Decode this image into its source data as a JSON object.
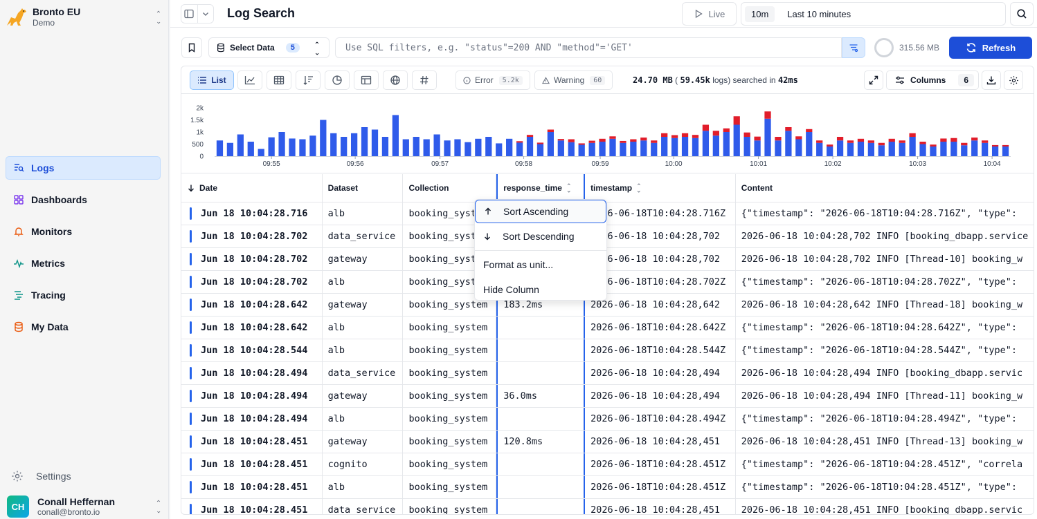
{
  "sidebar": {
    "org_name": "Bronto EU",
    "org_sub": "Demo",
    "nav": [
      {
        "label": "Logs",
        "icon": "logs-icon",
        "active": true
      },
      {
        "label": "Dashboards",
        "icon": "dashboards-icon"
      },
      {
        "label": "Monitors",
        "icon": "bell-icon"
      },
      {
        "label": "Metrics",
        "icon": "activity-icon"
      },
      {
        "label": "Tracing",
        "icon": "tracing-icon"
      },
      {
        "label": "My Data",
        "icon": "database-icon"
      }
    ],
    "settings_label": "Settings",
    "user": {
      "initials": "CH",
      "name": "Conall Heffernan",
      "email": "conall@bronto.io"
    }
  },
  "topbar": {
    "title": "Log Search",
    "live_label": "Live",
    "time_chip": "10m",
    "time_range": "Last 10 minutes"
  },
  "filter": {
    "select_label": "Select Data",
    "select_count": "5",
    "sql_placeholder": "Use SQL filters, e.g. \"status\"=200 AND \"method\"='GET'",
    "memory": "315.56 MB",
    "refresh_label": "Refresh"
  },
  "toolbar": {
    "list_label": "List",
    "error_label": "Error",
    "error_count": "5.2k",
    "warning_label": "Warning",
    "warning_count": "60",
    "stats_size": "24.70 MB",
    "stats_open": "(",
    "stats_logs": "59.45k",
    "stats_logs_unit": "logs)",
    "stats_searched": "searched",
    "stats_in": "in",
    "stats_time": "42ms",
    "columns_label": "Columns",
    "columns_count": "6"
  },
  "colors": {
    "info_bar": "#2f5bea",
    "error_bar": "#e11d2a",
    "accent": "#1d4ed8"
  },
  "chart_data": {
    "type": "bar",
    "stacked": true,
    "y_ticks": [
      "2k",
      "1.5k",
      "1k",
      "500",
      "0"
    ],
    "x_ticks": [
      "09:55",
      "09:56",
      "09:57",
      "09:58",
      "09:59",
      "10:00",
      "10:01",
      "10:02",
      "10:03",
      "10:04"
    ],
    "ylim": [
      0,
      2000
    ],
    "series": [
      {
        "values": [
          650,
          550,
          900,
          600,
          300,
          780,
          1000,
          730,
          700,
          850,
          1500,
          950,
          800,
          950,
          1200,
          1100,
          800,
          1700,
          700,
          800,
          700,
          900,
          650,
          700,
          580,
          720,
          800,
          530,
          720,
          560,
          800,
          500,
          1000,
          650,
          580,
          470,
          550,
          600,
          720,
          550,
          600,
          650,
          550,
          800,
          750,
          800,
          750,
          1050,
          850,
          1000,
          1300,
          800,
          650,
          1550,
          650,
          1050,
          700,
          1000,
          550,
          400,
          650,
          550,
          600,
          550,
          450,
          600,
          550,
          800,
          500,
          400,
          600,
          600,
          450,
          650,
          550,
          400,
          400
        ]
      },
      {
        "name": "Error",
        "values": [
          0,
          0,
          0,
          0,
          0,
          0,
          0,
          0,
          0,
          0,
          0,
          0,
          0,
          0,
          0,
          0,
          0,
          0,
          0,
          0,
          0,
          0,
          0,
          0,
          0,
          0,
          0,
          0,
          0,
          60,
          80,
          60,
          100,
          60,
          120,
          60,
          90,
          120,
          100,
          80,
          100,
          120,
          100,
          150,
          120,
          150,
          130,
          250,
          200,
          150,
          350,
          180,
          160,
          300,
          150,
          150,
          120,
          120,
          100,
          80,
          150,
          100,
          120,
          100,
          100,
          120,
          100,
          150,
          100,
          80,
          130,
          150,
          100,
          120,
          100,
          60,
          60
        ]
      }
    ]
  },
  "table": {
    "columns": [
      "Date",
      "Dataset",
      "Collection",
      "response_time",
      "timestamp",
      "Content"
    ],
    "rows": [
      {
        "date": "Jun 18 10:04:28.716",
        "dataset": "alb",
        "collection": "booking_system",
        "rt": "",
        "ts": "2026-06-18T10:04:28.716Z",
        "content": "{\"timestamp\": \"2026-06-18T10:04:28.716Z\", \"type\":"
      },
      {
        "date": "Jun 18 10:04:28.702",
        "dataset": "data_service",
        "collection": "booking_system",
        "rt": "",
        "ts": "2026-06-18 10:04:28,702",
        "content": "2026-06-18 10:04:28,702 INFO [booking_dbapp.service"
      },
      {
        "date": "Jun 18 10:04:28.702",
        "dataset": "gateway",
        "collection": "booking_system",
        "rt": "",
        "ts": "2026-06-18 10:04:28,702",
        "content": "2026-06-18 10:04:28,702 INFO [Thread-10] booking_w"
      },
      {
        "date": "Jun 18 10:04:28.702",
        "dataset": "alb",
        "collection": "booking_system",
        "rt": "",
        "ts": "2026-06-18T10:04:28.702Z",
        "content": "{\"timestamp\": \"2026-06-18T10:04:28.702Z\", \"type\":"
      },
      {
        "date": "Jun 18 10:04:28.642",
        "dataset": "gateway",
        "collection": "booking_system",
        "rt": "183.2ms",
        "ts": "2026-06-18 10:04:28,642",
        "content": "2026-06-18 10:04:28,642 INFO [Thread-18] booking_w"
      },
      {
        "date": "Jun 18 10:04:28.642",
        "dataset": "alb",
        "collection": "booking_system",
        "rt": "",
        "ts": "2026-06-18T10:04:28.642Z",
        "content": "{\"timestamp\": \"2026-06-18T10:04:28.642Z\", \"type\":"
      },
      {
        "date": "Jun 18 10:04:28.544",
        "dataset": "alb",
        "collection": "booking_system",
        "rt": "",
        "ts": "2026-06-18T10:04:28.544Z",
        "content": "{\"timestamp\": \"2026-06-18T10:04:28.544Z\", \"type\":"
      },
      {
        "date": "Jun 18 10:04:28.494",
        "dataset": "data_service",
        "collection": "booking_system",
        "rt": "",
        "ts": "2026-06-18 10:04:28,494",
        "content": "2026-06-18 10:04:28,494 INFO [booking_dbapp.servic"
      },
      {
        "date": "Jun 18 10:04:28.494",
        "dataset": "gateway",
        "collection": "booking_system",
        "rt": "36.0ms",
        "ts": "2026-06-18 10:04:28,494",
        "content": "2026-06-18 10:04:28,494 INFO [Thread-11] booking_w"
      },
      {
        "date": "Jun 18 10:04:28.494",
        "dataset": "alb",
        "collection": "booking_system",
        "rt": "",
        "ts": "2026-06-18T10:04:28.494Z",
        "content": "{\"timestamp\": \"2026-06-18T10:04:28.494Z\", \"type\":"
      },
      {
        "date": "Jun 18 10:04:28.451",
        "dataset": "gateway",
        "collection": "booking_system",
        "rt": "120.8ms",
        "ts": "2026-06-18 10:04:28,451",
        "content": "2026-06-18 10:04:28,451 INFO [Thread-13] booking_w"
      },
      {
        "date": "Jun 18 10:04:28.451",
        "dataset": "cognito",
        "collection": "booking_system",
        "rt": "",
        "ts": "2026-06-18T10:04:28.451Z",
        "content": "{\"timestamp\": \"2026-06-18T10:04:28.451Z\", \"correla"
      },
      {
        "date": "Jun 18 10:04:28.451",
        "dataset": "alb",
        "collection": "booking_system",
        "rt": "",
        "ts": "2026-06-18T10:04:28.451Z",
        "content": "{\"timestamp\": \"2026-06-18T10:04:28.451Z\", \"type\":"
      },
      {
        "date": "Jun 18 10:04:28.451",
        "dataset": "data_service",
        "collection": "booking_system",
        "rt": "",
        "ts": "2026-06-18 10:04:28,451",
        "content": "2026-06-18 10:04:28,451 INFO [booking_dbapp.servic"
      }
    ]
  },
  "menu": {
    "sort_asc": "Sort Ascending",
    "sort_desc": "Sort Descending",
    "format_unit": "Format as unit...",
    "hide_column": "Hide Column"
  }
}
